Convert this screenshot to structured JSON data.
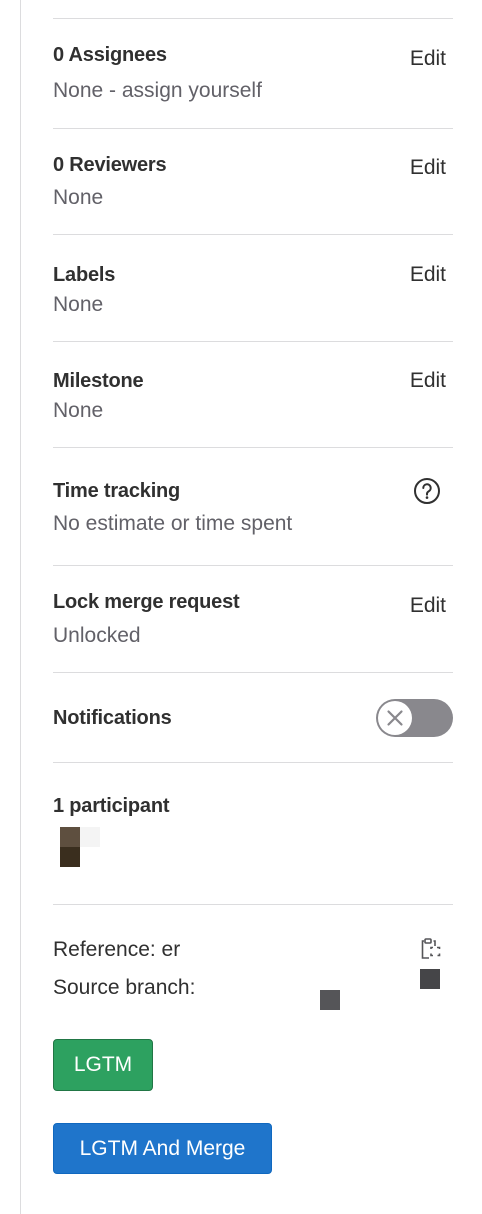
{
  "assignees": {
    "title": "0 Assignees",
    "edit_label": "Edit",
    "value": "None - assign yourself"
  },
  "reviewers": {
    "title": "0 Reviewers",
    "edit_label": "Edit",
    "value": "None"
  },
  "labels": {
    "title": "Labels",
    "edit_label": "Edit",
    "value": "None"
  },
  "milestone": {
    "title": "Milestone",
    "edit_label": "Edit",
    "value": "None"
  },
  "time_tracking": {
    "title": "Time tracking",
    "value": "No estimate or time spent",
    "icon": "question-circle-icon"
  },
  "lock": {
    "title": "Lock merge request",
    "edit_label": "Edit",
    "value": "Unlocked"
  },
  "notifications": {
    "title": "Notifications",
    "toggle_on": false
  },
  "participants": {
    "title": "1 participant"
  },
  "reference": {
    "label": "Reference: er",
    "icon": "copy-to-clipboard-icon"
  },
  "source_branch": {
    "label": "Source branch:"
  },
  "actions": {
    "lgtm": "LGTM",
    "lgtm_merge": "LGTM And Merge"
  },
  "colors": {
    "lgtm_green": "#2da160",
    "merge_blue": "#1f75cb",
    "toggle_off": "#89888d"
  }
}
